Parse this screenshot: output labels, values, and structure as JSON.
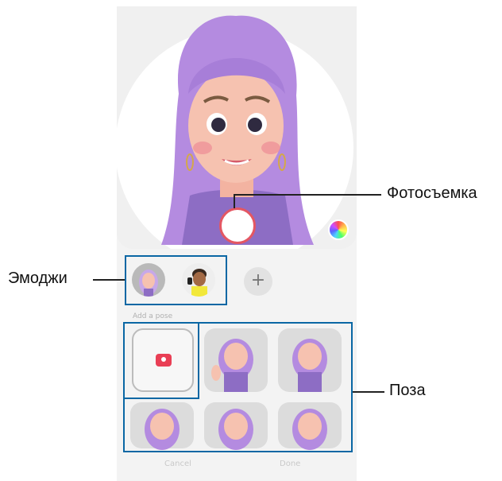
{
  "callouts": {
    "capture": "Фотосъемка",
    "emoji": "Эмоджи",
    "pose": "Поза"
  },
  "add_button": "+",
  "section_label": "Add a pose",
  "footer": {
    "cancel": "Cancel",
    "done": "Done"
  },
  "colors": {
    "accent": "#e45763",
    "callout_border": "#0a67a4",
    "camera_red": "#e93f55",
    "hair": "#b48be0"
  }
}
